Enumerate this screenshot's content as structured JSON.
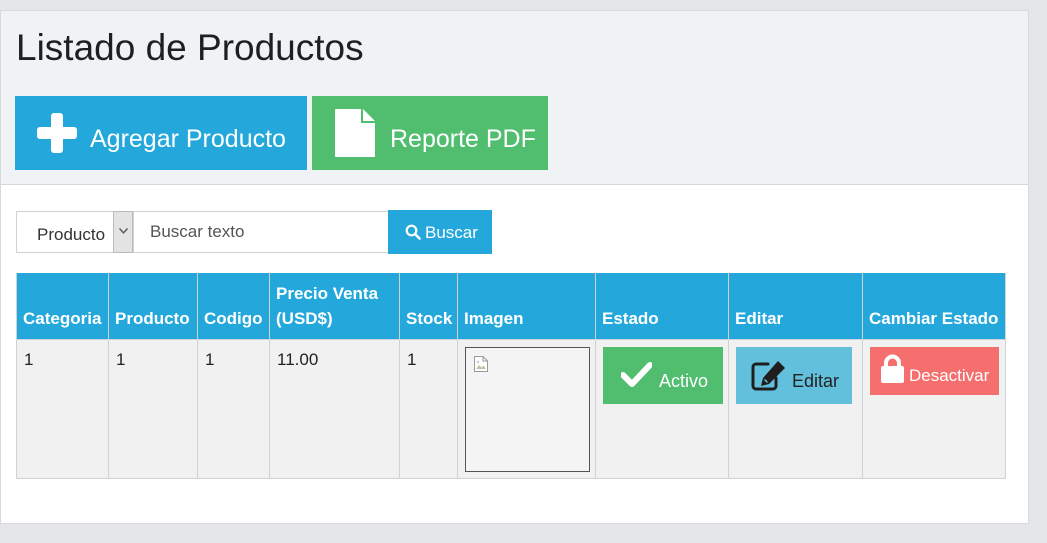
{
  "page": {
    "title": "Listado de Productos"
  },
  "toolbar": {
    "add_label": "Agregar Producto",
    "pdf_label": "Reporte PDF"
  },
  "search": {
    "filter_value": "Producto",
    "placeholder": "Buscar texto",
    "button_label": "Buscar"
  },
  "table": {
    "columns": [
      "Categoria",
      "Producto",
      "Codigo",
      "Precio Venta (USD$)",
      "Stock",
      "Imagen",
      "Estado",
      "Editar",
      "Cambiar Estado"
    ],
    "rows": [
      {
        "categoria": "1",
        "producto": "1",
        "codigo": "1",
        "precio": "11.00",
        "stock": "1",
        "estado_label": "Activo",
        "editar_label": "Editar",
        "cambiar_label": "Desactivar"
      }
    ]
  },
  "icons": {
    "add": "plus-icon",
    "pdf": "file-icon",
    "search": "search-icon",
    "estado": "check-icon",
    "editar": "edit-icon",
    "cambiar": "lock-icon",
    "imagen": "broken-image-icon"
  },
  "colors": {
    "primary": "#24a8dc",
    "success": "#50bd6f",
    "info": "#62c0dd",
    "danger": "#f56f6f"
  }
}
